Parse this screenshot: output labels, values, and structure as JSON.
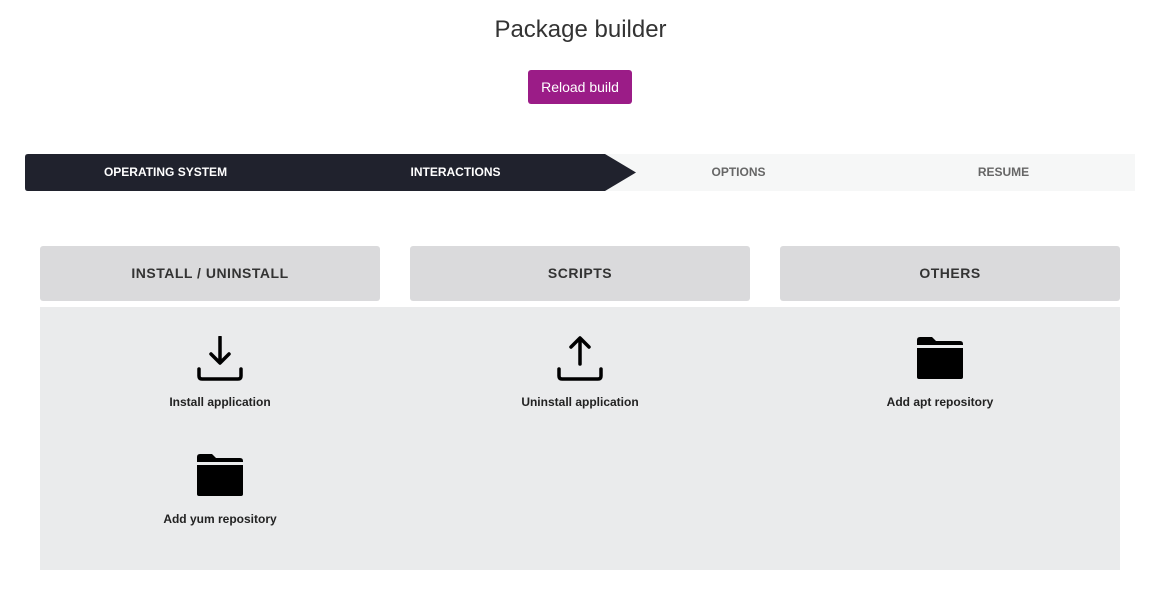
{
  "header": {
    "title": "Package builder",
    "reload_label": "Reload build"
  },
  "stepper": {
    "steps": [
      {
        "label": "OPERATING SYSTEM",
        "state": "done"
      },
      {
        "label": "INTERACTIONS",
        "state": "current"
      },
      {
        "label": "OPTIONS",
        "state": "todo"
      },
      {
        "label": "RESUME",
        "state": "todo"
      }
    ],
    "active_color": "#20222d"
  },
  "categories": [
    {
      "label": "INSTALL / UNINSTALL"
    },
    {
      "label": "SCRIPTS"
    },
    {
      "label": "OTHERS"
    }
  ],
  "items": [
    {
      "label": "Install application",
      "icon": "download-icon"
    },
    {
      "label": "Uninstall application",
      "icon": "upload-icon"
    },
    {
      "label": "Add apt repository",
      "icon": "folder-icon"
    },
    {
      "label": "Add yum repository",
      "icon": "folder-icon"
    }
  ]
}
